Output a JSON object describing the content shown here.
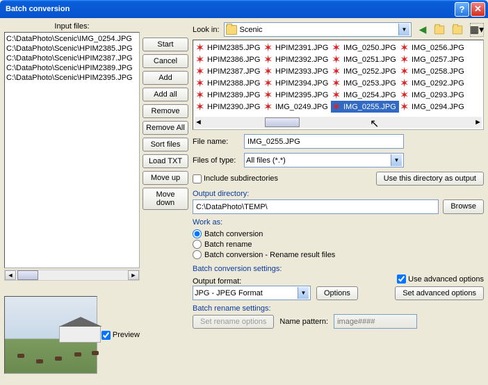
{
  "titlebar": {
    "title": "Batch conversion"
  },
  "input_files": {
    "label": "Input files:",
    "items": [
      "C:\\DataPhoto\\Scenic\\IMG_0254.JPG",
      "C:\\DataPhoto\\Scenic\\HPIM2385.JPG",
      "C:\\DataPhoto\\Scenic\\HPIM2387.JPG",
      "C:\\DataPhoto\\Scenic\\HPIM2389.JPG",
      "C:\\DataPhoto\\Scenic\\HPIM2395.JPG"
    ]
  },
  "buttons": {
    "start": "Start",
    "cancel": "Cancel",
    "add": "Add",
    "add_all": "Add all",
    "remove": "Remove",
    "remove_all": "Remove All",
    "sort": "Sort files",
    "load_txt": "Load TXT",
    "move_up": "Move up",
    "move_down": "Move down"
  },
  "preview": {
    "label": "Preview",
    "checked": true
  },
  "lookin": {
    "label": "Look in:",
    "value": "Scenic"
  },
  "browser_files": [
    "HPIM2385.JPG",
    "HPIM2386.JPG",
    "HPIM2387.JPG",
    "HPIM2388.JPG",
    "HPIM2389.JPG",
    "HPIM2390.JPG",
    "HPIM2391.JPG",
    "HPIM2392.JPG",
    "HPIM2393.JPG",
    "HPIM2394.JPG",
    "HPIM2395.JPG",
    "IMG_0249.JPG",
    "IMG_0250.JPG",
    "IMG_0251.JPG",
    "IMG_0252.JPG",
    "IMG_0253.JPG",
    "IMG_0254.JPG",
    "IMG_0255.JPG",
    "IMG_0256.JPG",
    "IMG_0257.JPG",
    "IMG_0258.JPG",
    "IMG_0292.JPG",
    "IMG_0293.JPG",
    "IMG_0294.JPG"
  ],
  "browser_selected_index": 17,
  "filename": {
    "label": "File name:",
    "value": "IMG_0255.JPG"
  },
  "filetype": {
    "label": "Files of type:",
    "value": "All files (*.*)"
  },
  "include_subdirs": {
    "label": "Include subdirectories",
    "checked": false
  },
  "use_dir_output": "Use this directory as output",
  "output_dir": {
    "title": "Output directory:",
    "value": "C:\\DataPhoto\\TEMP\\",
    "browse": "Browse"
  },
  "work_as": {
    "title": "Work as:",
    "options": [
      {
        "label": "Batch conversion",
        "checked": true
      },
      {
        "label": "Batch rename",
        "checked": false
      },
      {
        "label": "Batch conversion - Rename result files",
        "checked": false
      }
    ]
  },
  "bcs": {
    "title": "Batch conversion settings:",
    "output_format_label": "Output format:",
    "output_format": "JPG - JPEG Format",
    "options_btn": "Options",
    "use_adv": "Use advanced options",
    "use_adv_checked": true,
    "set_adv": "Set advanced options"
  },
  "brs": {
    "title": "Batch rename settings:",
    "set_rename": "Set rename options",
    "name_pattern_label": "Name pattern:",
    "name_pattern_placeholder": "image####"
  }
}
